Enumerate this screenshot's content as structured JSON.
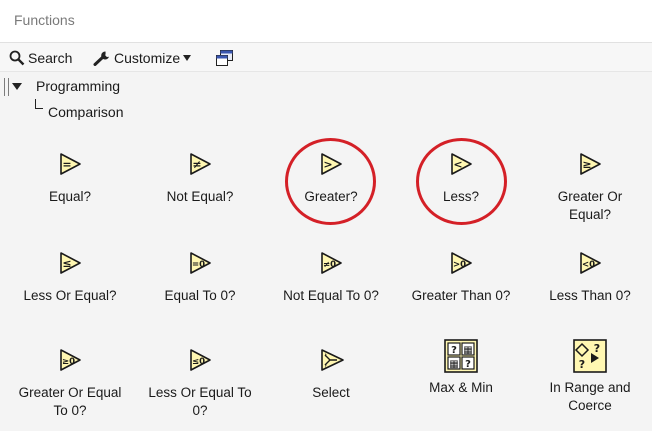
{
  "window": {
    "title": "Functions"
  },
  "toolbar": {
    "search_label": "Search",
    "customize_label": "Customize"
  },
  "tree": {
    "root_label": "Programming",
    "child_label": "Comparison"
  },
  "functions": [
    {
      "label": "Equal?",
      "glyph": "="
    },
    {
      "label": "Not Equal?",
      "glyph": "≠"
    },
    {
      "label": "Greater?",
      "glyph": ">"
    },
    {
      "label": "Less?",
      "glyph": "<"
    },
    {
      "label": "Greater Or Equal?",
      "line1": "Greater Or",
      "line2": "Equal?",
      "glyph": "≥"
    },
    {
      "label": "Less Or Equal?",
      "glyph": "≤"
    },
    {
      "label": "Equal To 0?",
      "glyph": "=0"
    },
    {
      "label": "Not Equal To 0?",
      "glyph": "≠0"
    },
    {
      "label": "Greater Than 0?",
      "glyph": ">0"
    },
    {
      "label": "Less Than 0?",
      "glyph": "<0"
    },
    {
      "label": "Greater Or Equal To 0?",
      "line1": "Greater Or Equal",
      "line2": "To 0?",
      "glyph": "≥0"
    },
    {
      "label": "Less Or Equal To 0?",
      "line1": "Less Or Equal To",
      "line2": "0?",
      "glyph": "≤0"
    },
    {
      "label": "Select"
    },
    {
      "label": "Max & Min"
    },
    {
      "label": "In Range and Coerce",
      "line1": "In Range and",
      "line2": "Coerce"
    }
  ],
  "colors": {
    "icon_fill": "#fff7b2",
    "icon_stroke": "#1a1a1a",
    "highlight_circle": "#d42027"
  }
}
